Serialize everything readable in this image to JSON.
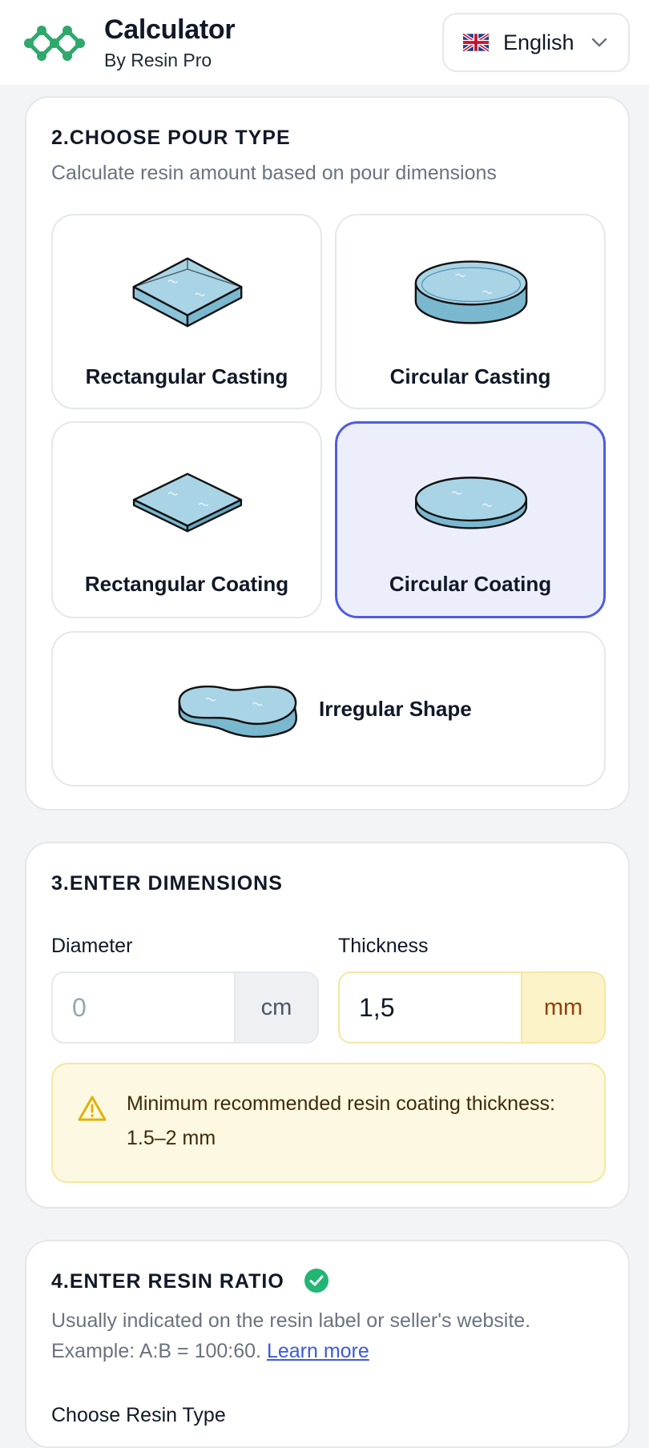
{
  "header": {
    "title": "Calculator",
    "subtitle": "By Resin Pro",
    "language": "English"
  },
  "pour_type": {
    "title": "2.CHOOSE POUR TYPE",
    "description": "Calculate resin amount based on pour dimensions",
    "options": [
      {
        "label": "Rectangular Casting",
        "selected": false
      },
      {
        "label": "Circular Casting",
        "selected": false
      },
      {
        "label": "Rectangular Coating",
        "selected": false
      },
      {
        "label": "Circular Coating",
        "selected": true
      },
      {
        "label": "Irregular Shape",
        "selected": false
      }
    ]
  },
  "dimensions": {
    "title": "3.ENTER DIMENSIONS",
    "diameter": {
      "label": "Diameter",
      "placeholder": "0",
      "value": "",
      "unit": "cm"
    },
    "thickness": {
      "label": "Thickness",
      "value": "1,5",
      "unit": "mm"
    },
    "warning": "Minimum recommended resin coating thickness: 1.5–2 mm"
  },
  "ratio": {
    "title": "4.ENTER RESIN RATIO",
    "description": "Usually indicated on the resin label or seller's website. Example: A:B = 100:60.",
    "learn_more": "Learn more",
    "resin_type_label": "Choose Resin Type"
  },
  "colors": {
    "accent": "#4f5ce0",
    "brand_green": "#2ea86b",
    "warning_bg": "#fdf8e1",
    "success": "#22b573"
  }
}
